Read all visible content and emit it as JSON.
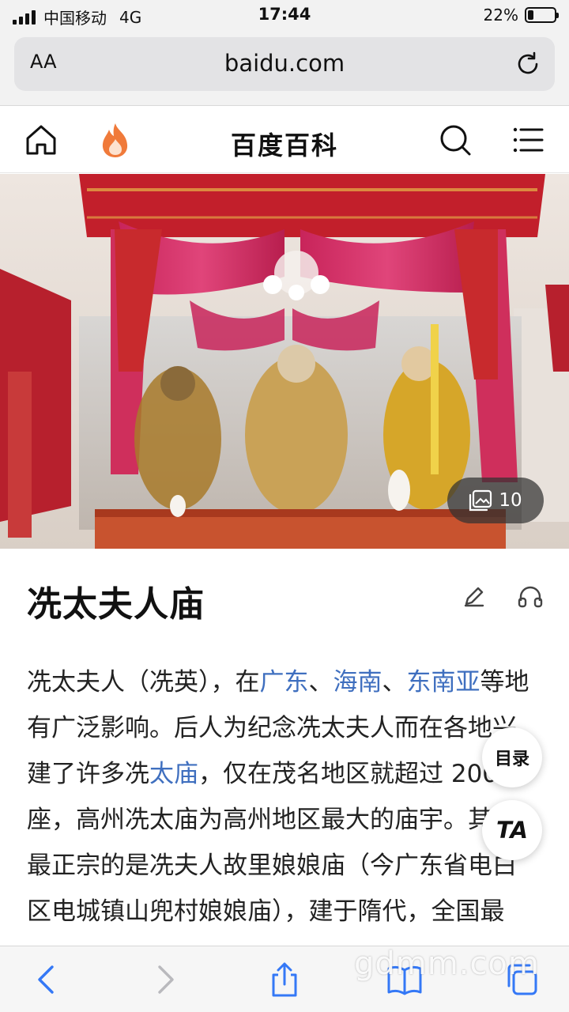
{
  "status_bar": {
    "carrier": "中国移动",
    "network": "4G",
    "time": "17:44",
    "battery": "22%",
    "battery_level": 0.22
  },
  "browser": {
    "text_size_label": "AA",
    "url": "baidu.com"
  },
  "baike_nav": {
    "title": "百度百科"
  },
  "hero": {
    "gallery_count": "10"
  },
  "article": {
    "title": "冼太夫人庙",
    "body": {
      "t1": "冼太夫人（冼英），在",
      "link_guangdong": "广东",
      "sep1": "、",
      "link_hainan": "海南",
      "sep2": "、",
      "link_sea": "东南亚",
      "t2": "等地有广泛影响。后人为纪念冼太夫人而在各地兴建了许多冼",
      "link_temple": "太庙",
      "t3": "，仅在茂名地区就超过 200 座，高州冼太庙为高州地区最大的庙宇。其中最正宗的是冼夫人故里娘娘庙（今广东省电白区电城镇山兜村娘娘庙），建于隋代，全国最有。庙造古朴"
    }
  },
  "floating": {
    "toc_label": "目录",
    "ta_label": "TA"
  },
  "watermark": "gdmm.com",
  "colors": {
    "link": "#3f6fbf",
    "ios_blue": "#3478f6",
    "fire": "#f07a3a"
  }
}
